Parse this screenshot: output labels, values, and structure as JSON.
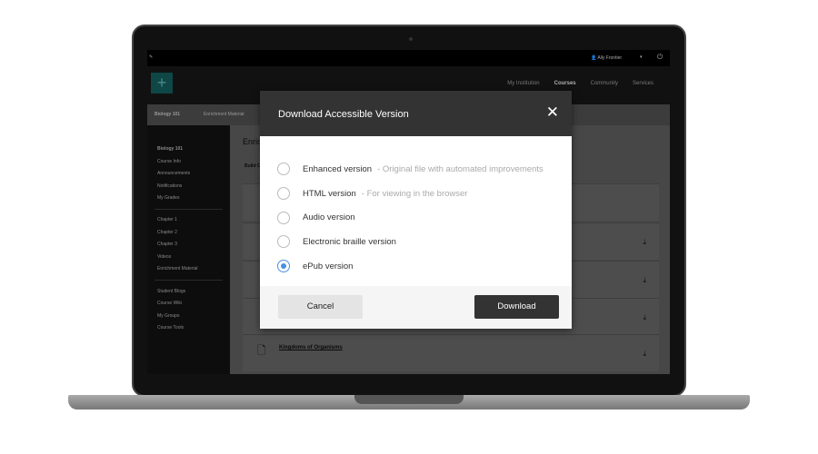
{
  "topbar": {
    "user": "Ally Frontier"
  },
  "nav": {
    "links": [
      "My Institution",
      "Courses",
      "Community",
      "Services"
    ],
    "active": "Courses"
  },
  "breadcrumb": {
    "course": "Biology 101",
    "page": "Enrichment Material"
  },
  "sidebar": {
    "course": "Biology 101",
    "group1": [
      "Course Info",
      "Announcements",
      "Notifications",
      "My Grades"
    ],
    "group2": [
      "Chapter 1",
      "Chapter 2",
      "Chapter 3",
      "Videos",
      "Enrichment Material"
    ],
    "group3": [
      "Student Blogs",
      "Course Wiki",
      "My Groups",
      "Course Tools"
    ]
  },
  "main": {
    "title": "Enrichment Material",
    "toolbar": "Build Content",
    "last_item": "Kingdoms of Organisms"
  },
  "modal": {
    "title": "Download Accessible Version",
    "options": [
      {
        "label": "Enhanced version",
        "desc": "- Original file with automated improvements",
        "selected": false
      },
      {
        "label": "HTML version",
        "desc": "- For viewing in the browser",
        "selected": false
      },
      {
        "label": "Audio version",
        "desc": "",
        "selected": false
      },
      {
        "label": "Electronic braille version",
        "desc": "",
        "selected": false
      },
      {
        "label": "ePub version",
        "desc": "",
        "selected": true
      }
    ],
    "cancel": "Cancel",
    "download": "Download"
  },
  "colors": {
    "accent": "#4a90e2",
    "logo": "#1f6f6f"
  }
}
